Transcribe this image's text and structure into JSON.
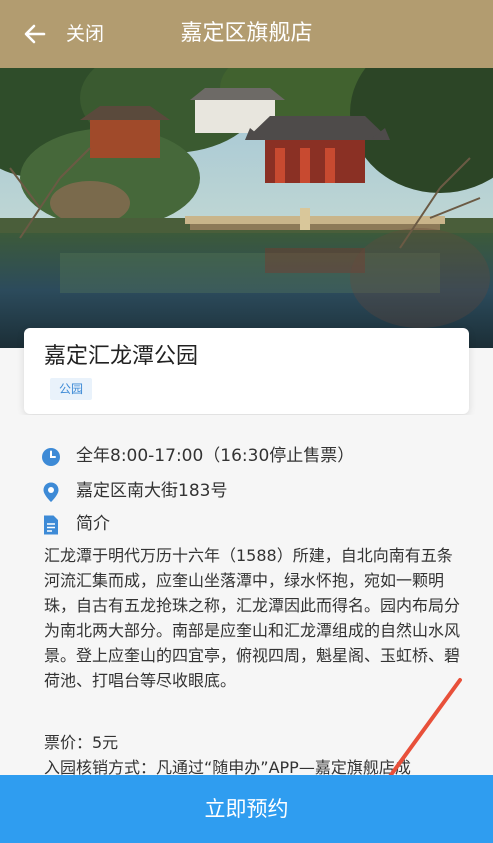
{
  "header": {
    "back_icon": "arrow-left-icon",
    "close_label": "关闭",
    "title": "嘉定区旗舰店"
  },
  "place": {
    "name": "嘉定汇龙潭公园",
    "tag": "公园"
  },
  "details": {
    "hours": "全年8:00-17:00（16:30停止售票）",
    "address": "嘉定区南大街183号",
    "intro_label": "简介",
    "description": "汇龙潭于明代万历十六年（1588）所建，自北向南有五条河流汇集而成，应奎山坐落潭中，绿水怀抱，宛如一颗明珠，自古有五龙抢珠之称，汇龙潭因此而得名。园内布局分为南北两大部分。南部是应奎山和汇龙潭组成的自然山水风景。登上应奎山的四宜亭，俯视四周，魁星阁、玉虹桥、碧荷池、打唱台等尽收眼底。",
    "price": "票价：5元",
    "verify": "入园核销方式：凡通过“随申办”APP—嘉定旗舰店成"
  },
  "footer": {
    "book_label": "立即预约"
  },
  "colors": {
    "header_bg": "#b29c70",
    "button_bg": "#2f9df0",
    "icon_blue": "#3d8ad6",
    "tag_bg": "#e9f2fb",
    "annotation_arrow": "#e8503a"
  },
  "icons": {
    "hours": "clock-icon",
    "address": "location-pin-icon",
    "intro": "document-icon"
  }
}
